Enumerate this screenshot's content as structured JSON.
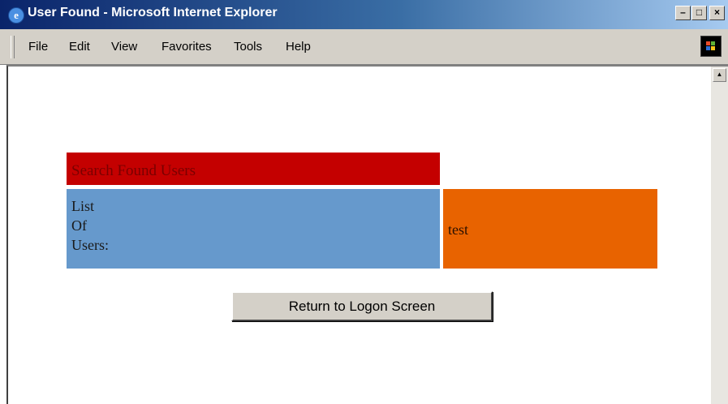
{
  "window": {
    "title": "User Found - Microsoft Internet Explorer",
    "app_icon": "ie-logo-icon",
    "controls": {
      "minimize_glyph": "–",
      "maximize_glyph": "□",
      "close_glyph": "×"
    }
  },
  "menubar": {
    "items": [
      {
        "label": "File"
      },
      {
        "label": "Edit"
      },
      {
        "label": "View"
      },
      {
        "label": "Favorites"
      },
      {
        "label": "Tools"
      },
      {
        "label": "Help"
      }
    ],
    "throbber_icon": "windows-logo-icon"
  },
  "page": {
    "header_text": "Search Found Users",
    "list_label_lines": [
      "List",
      "Of",
      "Users:"
    ],
    "users_value": "test",
    "return_button_label": "Return to Logon Screen"
  },
  "colors": {
    "header_bg": "#c40000",
    "list_bg": "#6699cc",
    "users_bg": "#e86300"
  }
}
